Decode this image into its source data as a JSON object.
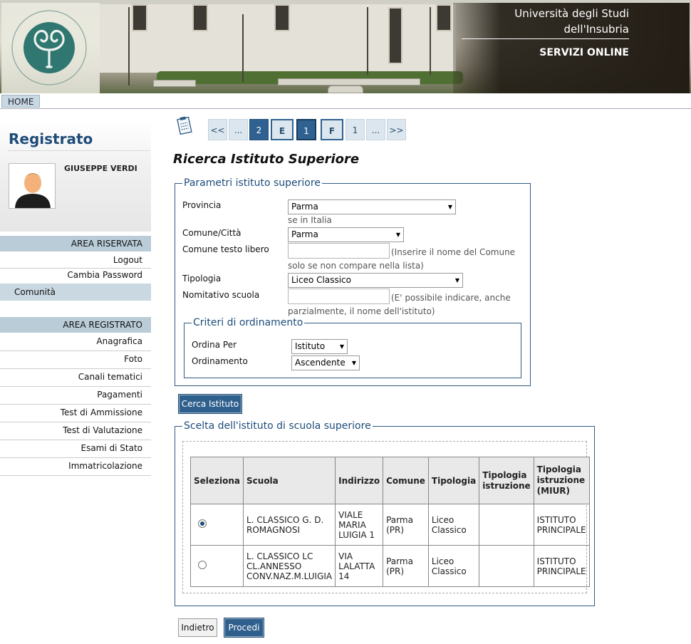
{
  "header": {
    "university_line1": "Università degli Studi",
    "university_line2": "dell'Insubria",
    "services": "SERVIZI ONLINE",
    "logo_text": "STUDIORUM UNIVERSITAS INSUBRIAE"
  },
  "topnav": {
    "home": "HOME"
  },
  "sidebar": {
    "title": "Registrato",
    "user_name": "GIUSEPPE VERDI",
    "area_riservata": "AREA RISERVATA",
    "reserved_links": [
      "Logout",
      "Cambia Password"
    ],
    "community": "Comunità",
    "area_registrato": "AREA REGISTRATO",
    "registered_links": [
      "Anagrafica",
      "Foto",
      "Canali tematici",
      "Pagamenti",
      "Test di Ammissione",
      "Test di Valutazione",
      "Esami di Stato",
      "Immatricolazione"
    ]
  },
  "pager": {
    "items": [
      "<<",
      "...",
      "2",
      "E",
      "1",
      "F",
      "1",
      "...",
      ">>"
    ]
  },
  "page": {
    "title": "Ricerca Istituto Superiore"
  },
  "params": {
    "legend": "Parametri istituto superiore",
    "provincia_label": "Provincia",
    "provincia_value": "Parma",
    "provincia_hint": "se in Italia",
    "comune_label": "Comune/Città",
    "comune_value": "Parma",
    "comune_libero_label": "Comune testo libero",
    "comune_libero_value": "",
    "comune_libero_hint1": "(Inserire il nome del Comune",
    "comune_libero_hint2": "solo se non compare nella lista)",
    "tipologia_label": "Tipologia",
    "tipologia_value": "Liceo Classico",
    "nominativo_label": "Nomitativo scuola",
    "nominativo_value": "",
    "nominativo_hint1": "(E' possibile indicare, anche",
    "nominativo_hint2": "parzialmente, il nome dell'istituto)"
  },
  "ordering": {
    "legend": "Criteri di ordinamento",
    "ordina_per_label": "Ordina Per",
    "ordina_per_value": "Istituto",
    "ordinamento_label": "Ordinamento",
    "ordinamento_value": "Ascendente"
  },
  "search_button": "Cerca Istituto",
  "results": {
    "legend": "Scelta dell'istituto di scuola superiore",
    "columns": [
      "Seleziona",
      "Scuola",
      "Indirizzo",
      "Comune",
      "Tipologia",
      "Tipologia istruzione",
      "Tipologia istruzione (MIUR)"
    ],
    "rows": [
      {
        "selected": true,
        "scuola": "L. CLASSICO G. D. ROMAGNOSI",
        "indirizzo": "VIALE MARIA LUIGIA 1",
        "comune": "Parma (PR)",
        "tipologia": "Liceo Classico",
        "istruzione": "",
        "miur": "ISTITUTO PRINCIPALE"
      },
      {
        "selected": false,
        "scuola": "L. CLASSICO LC CL.ANNESSO CONV.NAZ.M.LUIGIA",
        "indirizzo": "VIA LALATTA 14",
        "comune": "Parma (PR)",
        "tipologia": "Liceo Classico",
        "istruzione": "",
        "miur": "ISTITUTO PRINCIPALE"
      }
    ]
  },
  "footer_buttons": {
    "back": "Indietro",
    "next": "Procedi"
  },
  "colors": {
    "accent": "#2f6290",
    "sidebar_band": "#b9ccd8",
    "legend": "#1d4d7b"
  }
}
